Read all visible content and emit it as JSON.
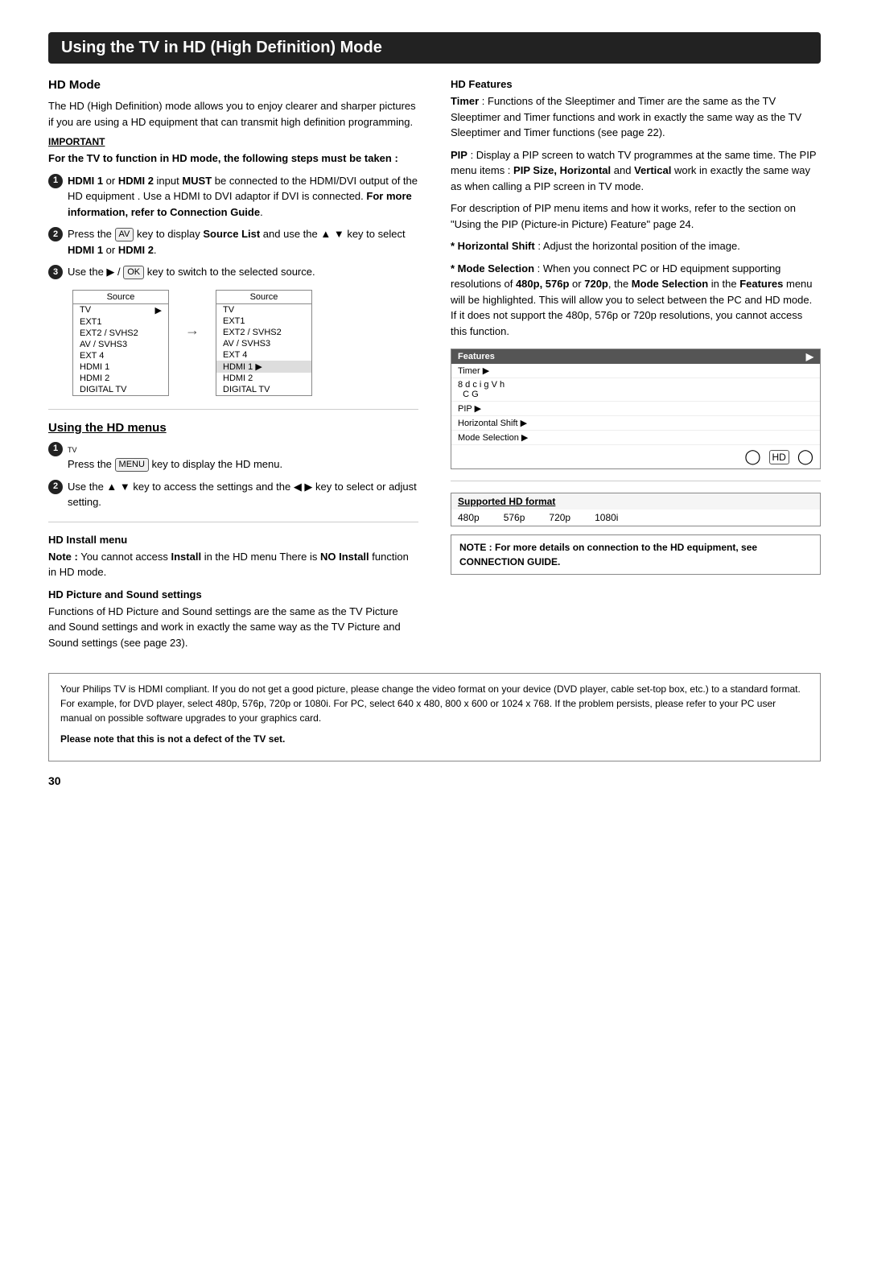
{
  "page": {
    "title": "Using the TV in HD (High Definition) Mode",
    "page_number": "30"
  },
  "hd_mode": {
    "heading": "HD Mode",
    "intro": "The HD (High Definition) mode allows you to enjoy clearer and sharper pictures if you are using a HD equipment that can transmit high definition programming.",
    "important_label": "IMPORTANT",
    "steps_heading": "For the TV to function in HD mode, the following steps must be taken :",
    "step1": "HDMI 1 or HDMI 2 input MUST be connected to the HDMI/DVI output of the HD equipment . Use a HDMI to DVI adaptor if DVI is connected. For more information, refer to Connection Guide.",
    "step2_text": "Press the",
    "step2_key": "AV",
    "step2_text2": "key to display Source List and use the ▲ ▼ key to select HDMI 1 or HDMI 2.",
    "step3_text": "Use the ▶ /",
    "step3_key": "OK",
    "step3_text2": "key to switch to the selected source.",
    "source_label": "Source",
    "source_items": [
      "TV",
      "EXT1",
      "EXT2 / SVHS2",
      "AV / SVHS3",
      "EXT 4",
      "HDMI 1",
      "HDMI 2",
      "DIGITAL TV"
    ],
    "source_items2": [
      "TV",
      "EXT1",
      "EXT2 / SVHS2",
      "AV / SVHS3",
      "EXT 4",
      "HDMI 1 ▶",
      "HDMI 2",
      "DIGITAL TV"
    ]
  },
  "hd_menus": {
    "heading": "Using the HD menus",
    "step1_text": "Press the",
    "step1_key": "MENU",
    "step1_text2": "key to display the HD menu.",
    "step2_text": "Use the ▲ ▼ key to access the settings and the ◀ ▶ key to select or adjust setting."
  },
  "hd_install": {
    "heading": "HD Install menu",
    "note": "Note : You cannot access Install in the HD menu There is NO Install function in HD mode."
  },
  "hd_picture": {
    "heading": "HD Picture and Sound settings",
    "text": "Functions of HD Picture and Sound settings are the same as the TV Picture and Sound settings and work in exactly the same way as the TV Picture and Sound settings (see page 23)."
  },
  "hd_features": {
    "heading": "HD Features",
    "timer_text": "Timer : Functions of the Sleeptimer and Timer are the same as the TV Sleeptimer and Timer functions and work in exactly the same way as the TV Sleeptimer and Timer functions (see page 22).",
    "pip_text": "PIP : Display a PIP screen to watch TV programmes at the same time. The PIP menu items : PIP Size, Horizontal and Vertical work in exactly the same way as when calling a PIP screen in TV mode.",
    "pip_note": "For description of PIP menu items and how it works, refer to the section on \"Using the PIP (Picture-in Picture) Feature\" page 24.",
    "horizontal_shift": "* Horizontal Shift : Adjust the horizontal position of the image.",
    "mode_selection": "* Mode Selection : When you connect PC or HD equipment supporting resolutions of 480p, 576p or 720p, the Mode Selection in the Features menu will be highlighted. This will allow you to select between the PC and HD mode. If it does not support the 480p, 576p or 720p resolutions, you cannot access this function.",
    "features_menu_items": [
      "Timer ▶",
      "8dcigVh CG",
      "PIP ▶",
      "Horizontal Shift ▶",
      "Mode Selection ▶"
    ]
  },
  "hd_format": {
    "heading": "Supported HD format",
    "formats": [
      "480p",
      "576p",
      "720p",
      "1080i"
    ]
  },
  "connection_note": {
    "text": "NOTE : For more details on connection to the HD equipment, see CONNECTION GUIDE."
  },
  "bottom_note": {
    "text": "Your Philips TV is HDMI compliant. If you do not get a good picture, please change the video format on your device (DVD player, cable set-top box, etc.) to a standard format. For example, for DVD player, select 480p, 576p, 720p or 1080i. For PC, select 640 x 480, 800 x 600 or 1024 x 768. If the problem persists, please refer to your PC user manual on possible software upgrades to your graphics card.",
    "bold_text": "Please note that this is not a defect of the TV set."
  },
  "labels": {
    "source": "Source",
    "features": "Features",
    "tv_label": "TV"
  }
}
